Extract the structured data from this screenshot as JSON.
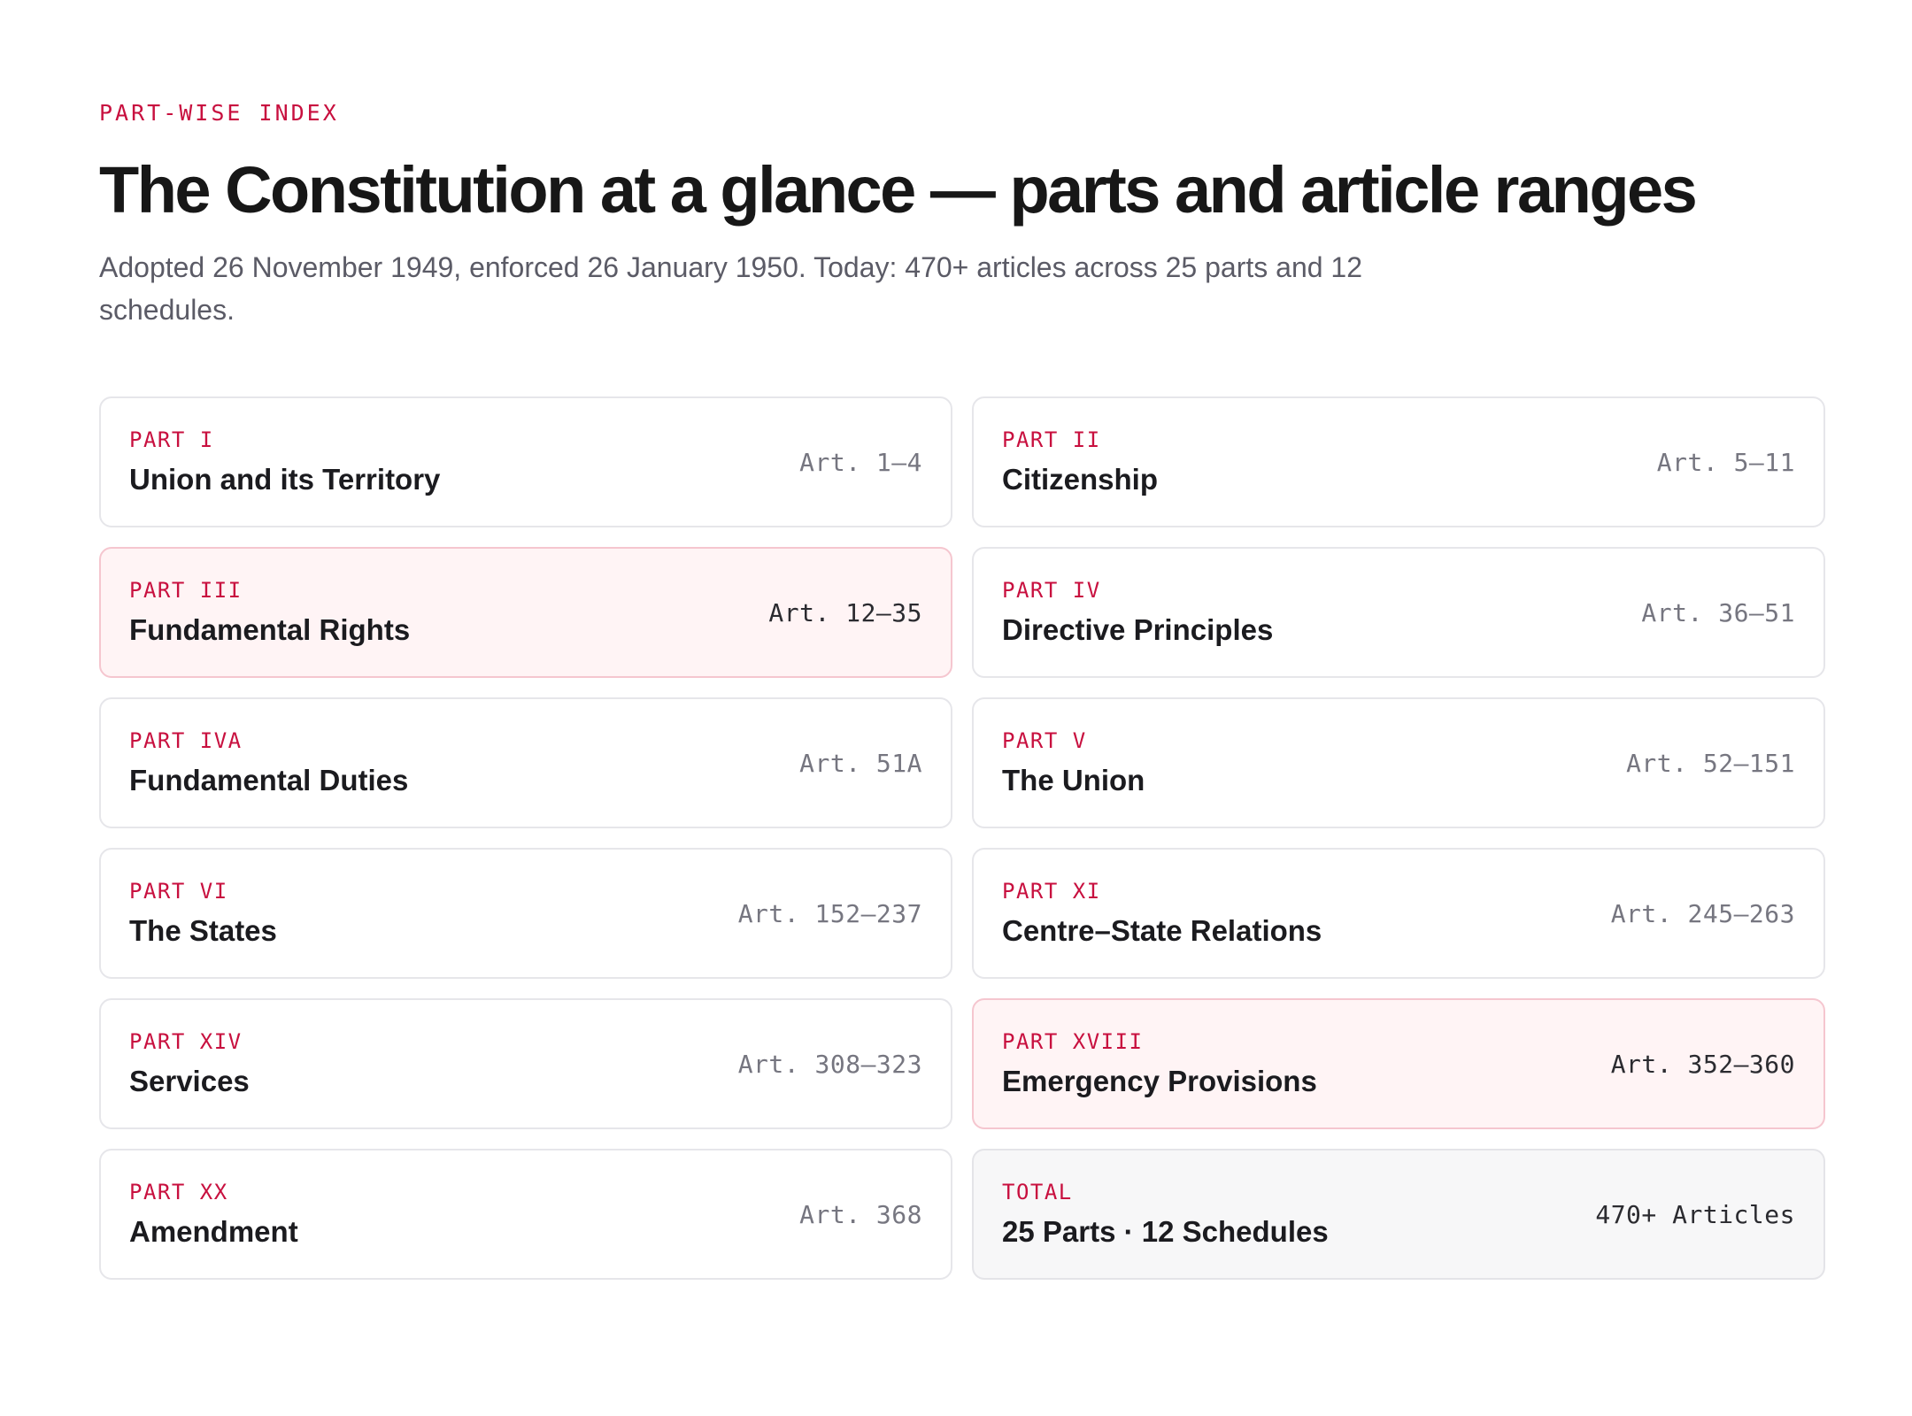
{
  "header": {
    "eyebrow": "PART-WISE INDEX",
    "title": "The Constitution at a glance — parts and article ranges",
    "subtitle": "Adopted 26 November 1949, enforced 26 January 1950. Today: 470+ articles across 25 parts and 12 schedules."
  },
  "colors": {
    "accent": "#c8103f",
    "highlight_bg": "#fff4f5",
    "highlight_border": "#f5c6cf",
    "total_bg": "#f7f7f8"
  },
  "parts": [
    {
      "label": "PART I",
      "name": "Union and its Territory",
      "range": "Art. 1–4"
    },
    {
      "label": "PART II",
      "name": "Citizenship",
      "range": "Art. 5–11"
    },
    {
      "label": "PART III",
      "name": "Fundamental Rights",
      "range": "Art. 12–35"
    },
    {
      "label": "PART IV",
      "name": "Directive Principles",
      "range": "Art. 36–51"
    },
    {
      "label": "PART IVA",
      "name": "Fundamental Duties",
      "range": "Art. 51A"
    },
    {
      "label": "PART V",
      "name": "The Union",
      "range": "Art. 52–151"
    },
    {
      "label": "PART VI",
      "name": "The States",
      "range": "Art. 152–237"
    },
    {
      "label": "PART XI",
      "name": "Centre–State Relations",
      "range": "Art. 245–263"
    },
    {
      "label": "PART XIV",
      "name": "Services",
      "range": "Art. 308–323"
    },
    {
      "label": "PART XVIII",
      "name": "Emergency Provisions",
      "range": "Art. 352–360"
    },
    {
      "label": "PART XX",
      "name": "Amendment",
      "range": "Art. 368"
    },
    {
      "label": "TOTAL",
      "name": "25 Parts · 12 Schedules",
      "range": "470+ Articles"
    }
  ]
}
